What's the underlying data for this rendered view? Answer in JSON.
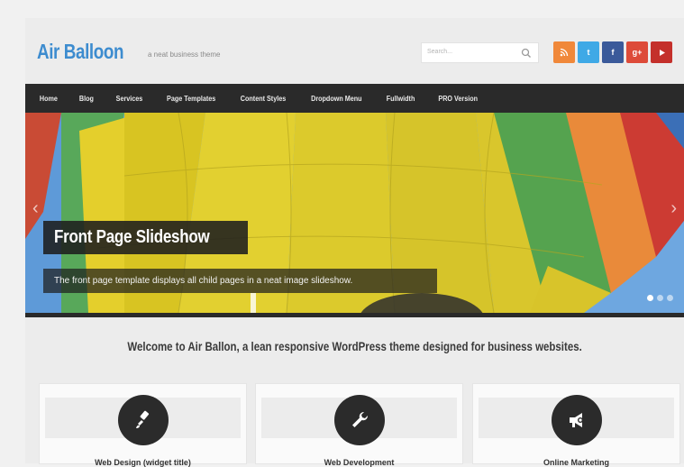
{
  "header": {
    "site_title": "Air Balloon",
    "tagline": "a neat business theme",
    "search_placeholder": "Search..."
  },
  "social": [
    {
      "name": "rss-icon",
      "glyph": ")",
      "color": "#f0883a"
    },
    {
      "name": "twitter-icon",
      "glyph": "t",
      "color": "#3fa9e6"
    },
    {
      "name": "facebook-icon",
      "glyph": "f",
      "color": "#3b5a9a"
    },
    {
      "name": "google-plus-icon",
      "glyph": "g+",
      "color": "#dd4b39"
    },
    {
      "name": "youtube-icon",
      "glyph": "▶",
      "color": "#c4302b"
    }
  ],
  "nav": {
    "items": [
      "Home",
      "Blog",
      "Services",
      "Page Templates",
      "Content Styles",
      "Dropdown Menu",
      "Fullwidth",
      "PRO Version"
    ]
  },
  "slider": {
    "title": "Front Page Slideshow",
    "caption": "The front page template displays all child pages in a neat image slideshow.",
    "prev_arrow": "‹",
    "next_arrow": "›"
  },
  "welcome": "Welcome to Air Ballon, a lean responsive WordPress theme designed for business websites.",
  "services": [
    {
      "title": "Web Design (widget title)",
      "icon": "paintbrush-icon"
    },
    {
      "title": "Web Development",
      "icon": "wrench-icon"
    },
    {
      "title": "Online Marketing",
      "icon": "megaphone-icon"
    }
  ],
  "colors": {
    "accent": "#3d8ccf",
    "nav_bg": "#2a2a2a"
  }
}
